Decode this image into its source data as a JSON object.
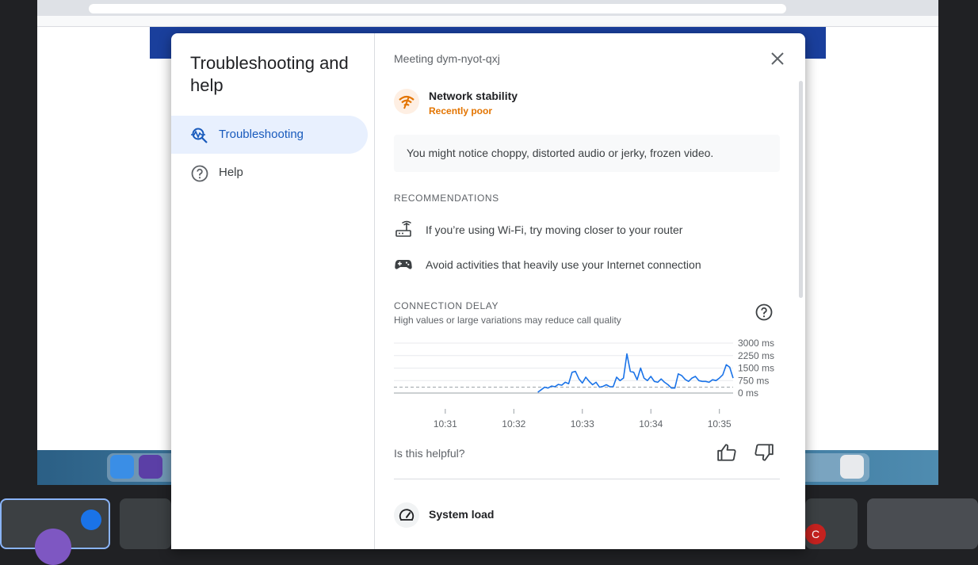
{
  "dialog": {
    "title": "Troubleshooting and help",
    "nav": [
      {
        "label": "Troubleshooting",
        "icon": "troubleshoot-icon",
        "selected": true
      },
      {
        "label": "Help",
        "icon": "help-circle-icon",
        "selected": false
      }
    ]
  },
  "panel": {
    "meeting_title": "Meeting dym-nyot-qxj",
    "network": {
      "title": "Network stability",
      "status": "Recently poor",
      "status_color": "#e37400",
      "icon": "wifi-warning-icon",
      "notice": "You might notice choppy, distorted audio or jerky, frozen video."
    },
    "recommendations_heading": "RECOMMENDATIONS",
    "recommendations": [
      {
        "icon": "router-icon",
        "text": "If you’re using Wi-Fi, try moving closer to your router"
      },
      {
        "icon": "gamepad-icon",
        "text": "Avoid activities that heavily use your Internet connection"
      }
    ],
    "delay": {
      "heading": "CONNECTION DELAY",
      "subtitle": "High values or large variations may reduce call quality"
    },
    "feedback_question": "Is this helpful?",
    "system_load": {
      "title": "System load",
      "icon": "speedometer-icon"
    }
  },
  "chart_data": {
    "type": "line",
    "title": "",
    "xlabel": "",
    "ylabel": "",
    "y_ticks": [
      "3000 ms",
      "2250 ms",
      "1500 ms",
      "750 ms",
      "0 ms"
    ],
    "y_tick_values": [
      3000,
      2250,
      1500,
      750,
      0
    ],
    "x_ticks": [
      "10:31",
      "10:32",
      "10:33",
      "10:34",
      "10:35"
    ],
    "ylim": [
      0,
      3000
    ],
    "xlim": [
      "10:30.25",
      "10:35.2"
    ],
    "grid": true,
    "line_color": "#1a73e8",
    "series": [
      {
        "x": [
          "10:32.35",
          "10:32.4",
          "10:32.45",
          "10:32.5",
          "10:32.55",
          "10:32.6",
          "10:32.65",
          "10:32.7",
          "10:32.75",
          "10:32.8",
          "10:32.85",
          "10:32.9",
          "10:32.95",
          "10:33.0",
          "10:33.05",
          "10:33.1",
          "10:33.15",
          "10:33.2",
          "10:33.25",
          "10:33.3",
          "10:33.35",
          "10:33.4",
          "10:33.45",
          "10:33.5",
          "10:33.55",
          "10:33.6",
          "10:33.65",
          "10:33.7",
          "10:33.75",
          "10:33.8",
          "10:33.85",
          "10:33.9",
          "10:33.95",
          "10:34.0",
          "10:34.05",
          "10:34.1",
          "10:34.15",
          "10:34.2",
          "10:34.25",
          "10:34.3",
          "10:34.35",
          "10:34.4",
          "10:34.45",
          "10:34.5",
          "10:34.55",
          "10:34.6",
          "10:34.65",
          "10:34.7",
          "10:34.75",
          "10:34.8",
          "10:34.85",
          "10:34.9",
          "10:34.95",
          "10:35.0",
          "10:35.05",
          "10:35.1",
          "10:35.15",
          "10:35.2"
        ],
        "values": [
          50,
          200,
          350,
          300,
          420,
          380,
          520,
          470,
          650,
          560,
          1250,
          1300,
          850,
          600,
          950,
          700,
          500,
          650,
          350,
          400,
          500,
          380,
          380,
          950,
          750,
          900,
          2350,
          1300,
          1250,
          800,
          1500,
          900,
          750,
          1000,
          700,
          650,
          850,
          650,
          500,
          300,
          300,
          1150,
          1050,
          820,
          700,
          900,
          1000,
          750,
          700,
          700,
          650,
          800,
          750,
          900,
          1100,
          1700,
          1550,
          900
        ]
      }
    ]
  }
}
